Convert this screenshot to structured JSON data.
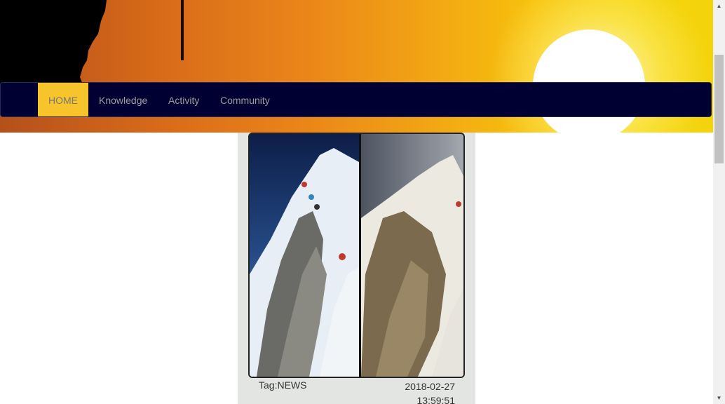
{
  "nav": {
    "items": [
      {
        "label": "HOME",
        "active": true
      },
      {
        "label": "Knowledge",
        "active": false
      },
      {
        "label": "Activity",
        "active": false
      },
      {
        "label": "Community",
        "active": false
      }
    ]
  },
  "post": {
    "tag": "Tag:NEWS",
    "date": "2018-02-27",
    "time": "13:59:51"
  },
  "colors": {
    "navbar_bg": "#000033",
    "active_nav": "#f7c52b",
    "card_bg": "#e2e5e1"
  }
}
